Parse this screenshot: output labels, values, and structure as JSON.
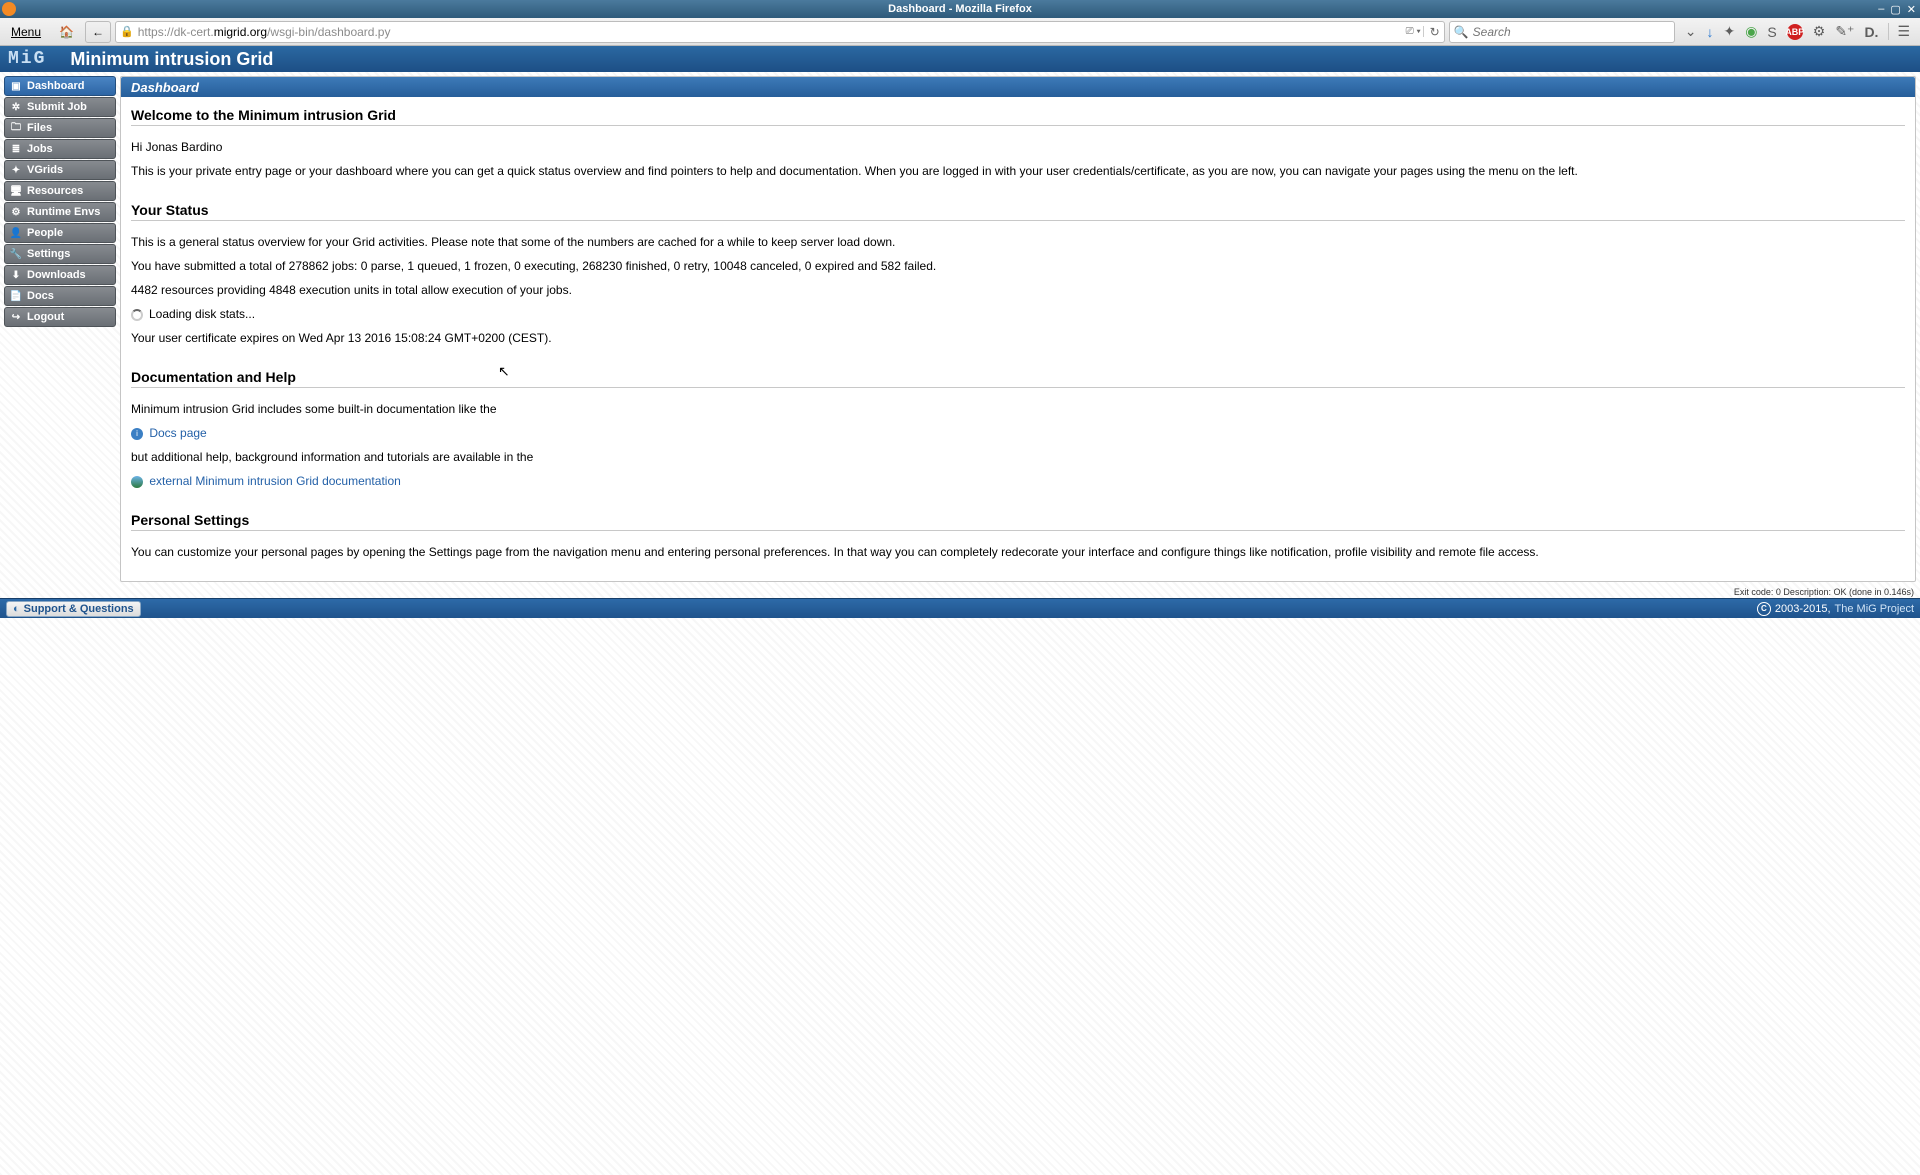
{
  "window": {
    "title": "Dashboard - Mozilla Firefox"
  },
  "chrome": {
    "menu_label": "Menu",
    "url_plain1": "https://dk-cert.",
    "url_highlight": "migrid.org",
    "url_plain2": "/wsgi-bin/dashboard.py",
    "search_placeholder": "Search"
  },
  "header": {
    "logo": "MiG",
    "title": "Minimum intrusion Grid"
  },
  "nav": {
    "items": [
      {
        "label": "Dashboard",
        "icon": "▣",
        "active": true
      },
      {
        "label": "Submit Job",
        "icon": "✲",
        "active": false
      },
      {
        "label": "Files",
        "icon": "🗀",
        "active": false
      },
      {
        "label": "Jobs",
        "icon": "≣",
        "active": false
      },
      {
        "label": "VGrids",
        "icon": "✦",
        "active": false
      },
      {
        "label": "Resources",
        "icon": "🖥",
        "active": false
      },
      {
        "label": "Runtime Envs",
        "icon": "⚙",
        "active": false
      },
      {
        "label": "People",
        "icon": "👤",
        "active": false
      },
      {
        "label": "Settings",
        "icon": "🔧",
        "active": false
      },
      {
        "label": "Downloads",
        "icon": "⬇",
        "active": false
      },
      {
        "label": "Docs",
        "icon": "📄",
        "active": false
      },
      {
        "label": "Logout",
        "icon": "↪",
        "active": false
      }
    ]
  },
  "page": {
    "panel_title": "Dashboard",
    "welcome_heading": "Welcome to the Minimum intrusion Grid",
    "greeting": "Hi Jonas Bardino",
    "intro": "This is your private entry page or your dashboard where you can get a quick status overview and find pointers to help and documentation. When you are logged in with your user credentials/certificate, as you are now, you can navigate your pages using the menu on the left.",
    "status_heading": "Your Status",
    "status_note": "This is a general status overview for your Grid activities. Please note that some of the numbers are cached for a while to keep server load down.",
    "jobs_line": "You have submitted a total of 278862 jobs: 0 parse, 1 queued, 1 frozen, 0 executing, 268230 finished, 0 retry, 10048 canceled, 0 expired and 582 failed.",
    "resources_line": "4482 resources providing 4848 execution units in total allow execution of your jobs.",
    "loading_line": "Loading disk stats...",
    "cert_line": "Your user certificate expires on Wed Apr 13 2016 15:08:24 GMT+0200 (CEST).",
    "docs_heading": "Documentation and Help",
    "docs_intro": "Minimum intrusion Grid includes some built-in documentation like the",
    "docs_link": "Docs page",
    "docs_mid": "but additional help, background information and tutorials are available in the",
    "external_link": "external Minimum intrusion Grid documentation",
    "settings_heading": "Personal Settings",
    "settings_text": "You can customize your personal pages by opening the Settings page from the navigation menu and entering personal preferences. In that way you can completely redecorate your interface and configure things like notification, profile visibility and remote file access.",
    "exit_line": "Exit code: 0 Description: OK (done in 0.146s)"
  },
  "footer": {
    "support": "Support & Questions",
    "copyright": "2003-2015,",
    "project_link": "The MiG Project"
  }
}
